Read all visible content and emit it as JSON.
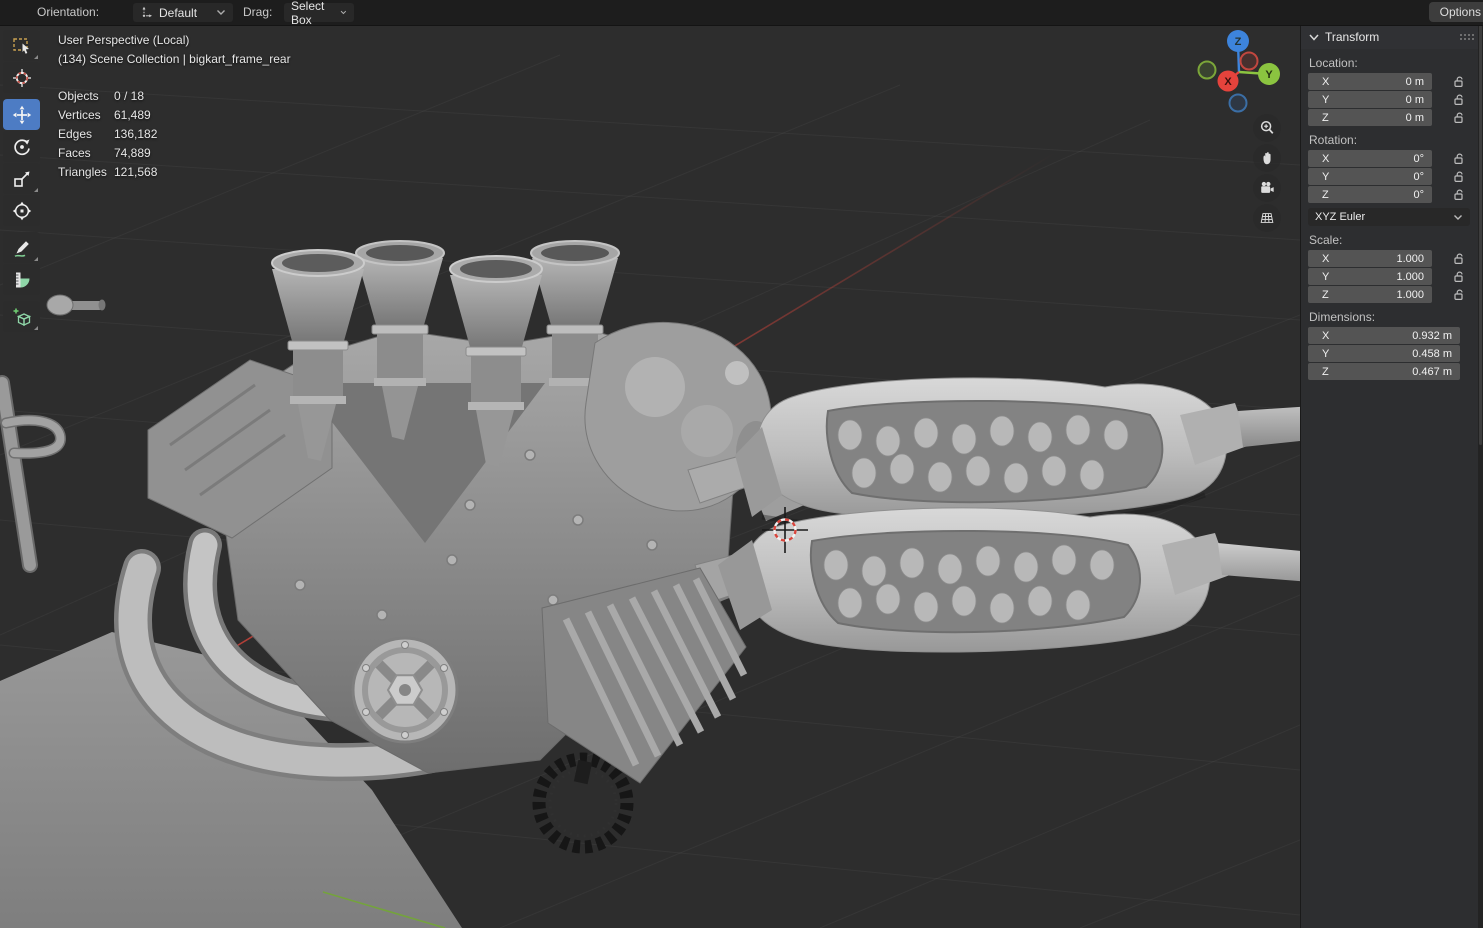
{
  "topbar": {
    "orientation_label": "Orientation:",
    "orientation_value": "Default",
    "drag_label": "Drag:",
    "drag_value": "Select Box",
    "options_button": "Options"
  },
  "toolbar": {
    "tools": [
      {
        "name": "select-box"
      },
      {
        "name": "cursor"
      },
      {
        "name": "move",
        "active": true
      },
      {
        "name": "rotate"
      },
      {
        "name": "scale"
      },
      {
        "name": "transform"
      },
      {
        "name": "annotate"
      },
      {
        "name": "measure"
      },
      {
        "name": "add-cube"
      }
    ]
  },
  "viewport": {
    "view_label": "User Perspective (Local)",
    "collection_label": "(134) Scene Collection | bigkart_frame_rear",
    "stats": [
      {
        "label": "Objects",
        "value": "0 / 18"
      },
      {
        "label": "Vertices",
        "value": "61,489"
      },
      {
        "label": "Edges",
        "value": "136,182"
      },
      {
        "label": "Faces",
        "value": "74,889"
      },
      {
        "label": "Triangles",
        "value": "121,568"
      }
    ]
  },
  "gizmo": {
    "x": "X",
    "y": "Y",
    "z": "Z"
  },
  "panel": {
    "title": "Transform",
    "location": {
      "label": "Location:",
      "rows": [
        {
          "axis": "X",
          "value": "0 m"
        },
        {
          "axis": "Y",
          "value": "0 m"
        },
        {
          "axis": "Z",
          "value": "0 m"
        }
      ]
    },
    "rotation": {
      "label": "Rotation:",
      "rows": [
        {
          "axis": "X",
          "value": "0°"
        },
        {
          "axis": "Y",
          "value": "0°"
        },
        {
          "axis": "Z",
          "value": "0°"
        }
      ],
      "mode": "XYZ Euler"
    },
    "scale": {
      "label": "Scale:",
      "rows": [
        {
          "axis": "X",
          "value": "1.000"
        },
        {
          "axis": "Y",
          "value": "1.000"
        },
        {
          "axis": "Z",
          "value": "1.000"
        }
      ]
    },
    "dimensions": {
      "label": "Dimensions:",
      "rows": [
        {
          "axis": "X",
          "value": "0.932 m"
        },
        {
          "axis": "Y",
          "value": "0.458 m"
        },
        {
          "axis": "Z",
          "value": "0.467 m"
        }
      ]
    }
  },
  "colors": {
    "accent_blue": "#4d7cc4",
    "axis_x_red": "#e5433c",
    "axis_y_green": "#8bc440",
    "axis_z_blue": "#3d84dc",
    "x_axis_line": "#b0443c",
    "y_axis_line": "#74a33c",
    "floor_gray": "#909090"
  }
}
